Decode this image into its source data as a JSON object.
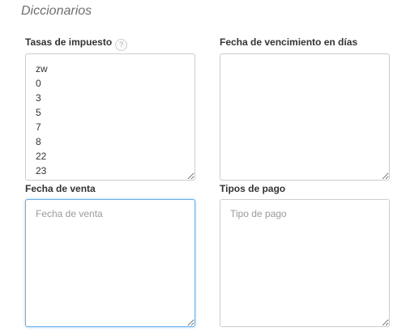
{
  "section": {
    "title": "Diccionarios"
  },
  "fields": {
    "tax_rates": {
      "label": "Tasas de impuesto",
      "help": "?",
      "value": "zw\n0\n3\n5\n7\n8\n22\n23",
      "placeholder": ""
    },
    "due_days": {
      "label": "Fecha de vencimiento en días",
      "value": "",
      "placeholder": ""
    },
    "sale_date": {
      "label": "Fecha de venta",
      "value": "",
      "placeholder": "Fecha de venta"
    },
    "payment_types": {
      "label": "Tipos de pago",
      "value": "",
      "placeholder": "Tipo de pago"
    }
  }
}
